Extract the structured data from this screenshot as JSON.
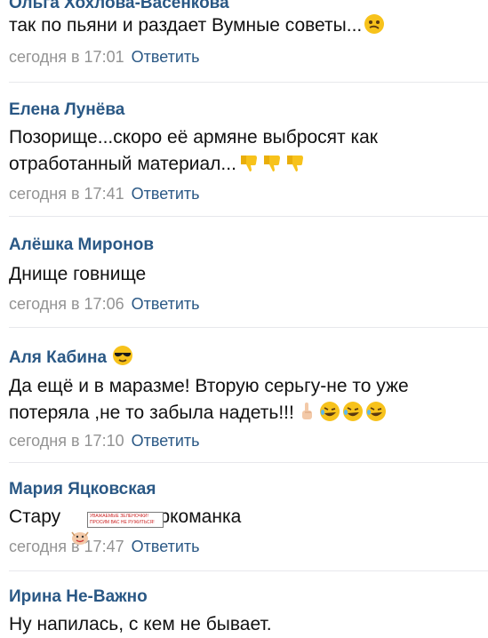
{
  "comments": [
    {
      "author": "Ольга Хохлова-Васенкова",
      "text_lines": [
        "так по пьяни и раздает Вумные советы..."
      ],
      "date": "сегодня в 17:01",
      "reply": "Ответить"
    },
    {
      "author": "Елена Лунёва",
      "text_lines": [
        "Позорище...скоро её армяне выбросят как",
        "отработанный материал..."
      ],
      "date": "сегодня в 17:41",
      "reply": "Ответить"
    },
    {
      "author": "Алёшка Миронов",
      "text_lines": [
        "Днище говнище"
      ],
      "date": "сегодня в 17:06",
      "reply": "Ответить"
    },
    {
      "author": "Аля Кабина",
      "text_lines": [
        "Да ещё и в маразме! Вторую серьгу-не то уже",
        "потеряла ,не то забыла надеть!!!"
      ],
      "date": "сегодня в 17:10",
      "reply": "Ответить"
    },
    {
      "author": "Мария Яцковская",
      "text_lines": [
        "Стару",
        "наркоманка"
      ],
      "date": "сегодня в 17:47",
      "reply": "Ответить"
    },
    {
      "author": "Ирина Не-Важно",
      "text_lines": [
        "Ну напилась, с кем не бывает."
      ],
      "date": "",
      "reply": ""
    }
  ],
  "sticker": {
    "text": "УВАЖАЕМЫЕ ЗЕЛЕНОЧКИ! ПРОСИМ ВАС НЕ РУЖИТЬСЯ!"
  },
  "icons": {
    "confused_face": "confused-face-emoji",
    "thumbs_down": "thumbs-down-emoji",
    "sunglasses_face": "smiling-face-with-sunglasses-emoji",
    "pointing_up": "index-pointing-up-emoji",
    "rofl": "rolling-on-the-floor-laughing-emoji"
  },
  "colors": {
    "author": "#2a5885",
    "reply": "#2a5885",
    "date": "#939393",
    "text": "#111111",
    "divider": "#e7e8ec",
    "emoji_yellow": "#f7c21b"
  }
}
